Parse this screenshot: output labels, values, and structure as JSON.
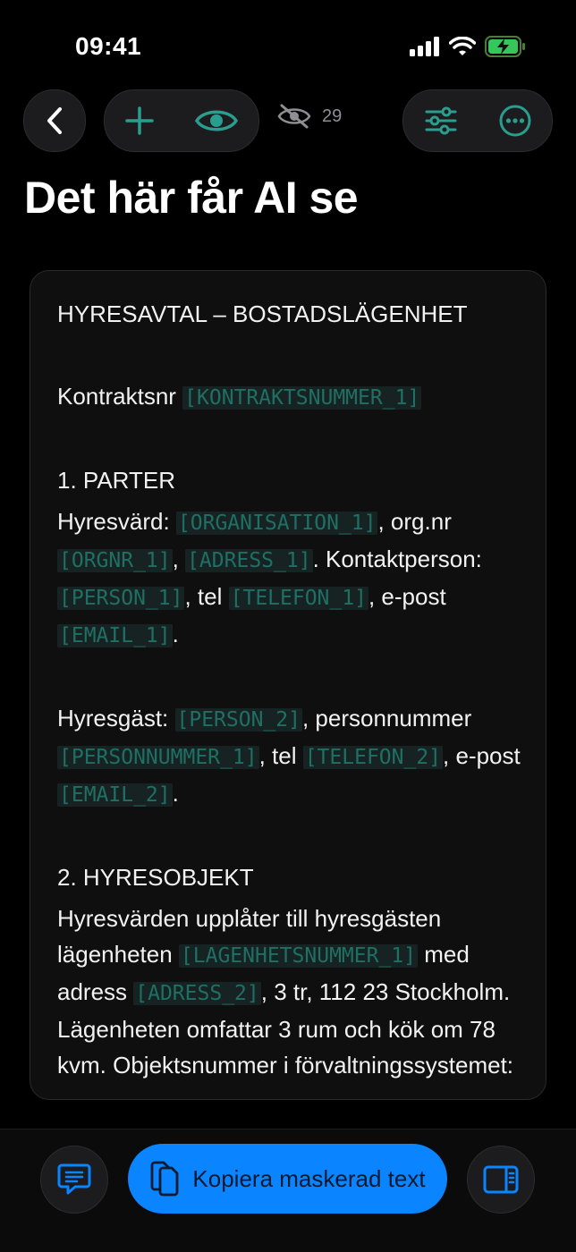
{
  "status": {
    "time": "09:41"
  },
  "toolbar": {
    "hidden_count": "29"
  },
  "page": {
    "title": "Det här får AI se"
  },
  "document": {
    "heading": "HYRESAVTAL – BOSTADSLÄGENHET",
    "contract_label": "Kontraktsnr ",
    "tag_kontraktsnummer": "[KONTRAKTSNUMMER_1]",
    "section1_title": "1. PARTER",
    "s1_t1": "Hyresvärd: ",
    "tag_org": "[ORGANISATION_1]",
    "s1_t2": ", org.nr ",
    "tag_orgnr": "[ORGNR_1]",
    "s1_t3": ", ",
    "tag_adress1": "[ADRESS_1]",
    "s1_t4": ". Kontaktperson: ",
    "tag_person1": "[PERSON_1]",
    "s1_t5": ", tel ",
    "tag_tel1": "[TELEFON_1]",
    "s1_t6": ", e-post ",
    "tag_email1": "[EMAIL_1]",
    "s1_t7": ".",
    "s1b_t1": "Hyresgäst: ",
    "tag_person2": "[PERSON_2]",
    "s1b_t2": ", personnummer ",
    "tag_pnr": "[PERSONNUMMER_1]",
    "s1b_t3": ", tel ",
    "tag_tel2": "[TELEFON_2]",
    "s1b_t4": ", e-post ",
    "tag_email2": "[EMAIL_2]",
    "s1b_t5": ".",
    "section2_title": "2. HYRESOBJEKT",
    "s2_t1": "Hyresvärden upplåter till hyresgästen lägenheten ",
    "tag_lgh": "[LAGENHETSNUMMER_1]",
    "s2_t2": " med adress ",
    "tag_adress2": "[ADRESS_2]",
    "s2_t3": ", 3 tr, 112 23 Stockholm. Lägenheten omfattar 3 rum och kök om 78 kvm. Objektsnummer i förvaltningssystemet:"
  },
  "bottom": {
    "copy_label": "Kopiera maskerad text"
  },
  "colors": {
    "accent": "#0a84ff",
    "tag_text": "#1f6f64",
    "icon_teal": "#2a9d8f"
  }
}
